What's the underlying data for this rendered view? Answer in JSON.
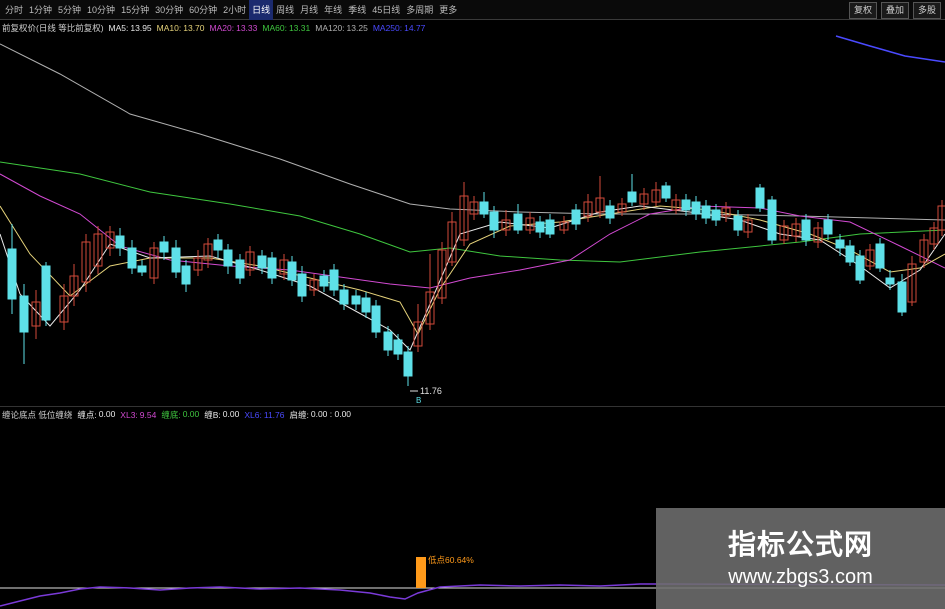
{
  "toolbar": {
    "tabs": [
      {
        "label": "分时",
        "active": false
      },
      {
        "label": "1分钟",
        "active": false
      },
      {
        "label": "5分钟",
        "active": false
      },
      {
        "label": "10分钟",
        "active": false
      },
      {
        "label": "15分钟",
        "active": false
      },
      {
        "label": "30分钟",
        "active": false
      },
      {
        "label": "60分钟",
        "active": false
      },
      {
        "label": "2小时",
        "active": false
      },
      {
        "label": "日线",
        "active": true
      },
      {
        "label": "周线",
        "active": false
      },
      {
        "label": "月线",
        "active": false
      },
      {
        "label": "年线",
        "active": false
      },
      {
        "label": "季线",
        "active": false
      },
      {
        "label": "45日线",
        "active": false
      },
      {
        "label": "多周期",
        "active": false
      },
      {
        "label": "更多",
        "active": false
      }
    ],
    "right_buttons": [
      "复权",
      "叠加",
      "多股"
    ]
  },
  "main_legend": {
    "title": "前复权价(日线 等比前复权)",
    "items": [
      {
        "label": "MA5:",
        "value": "13.95",
        "color": "#e8e8e8"
      },
      {
        "label": "MA10:",
        "value": "13.70",
        "color": "#e5d27a"
      },
      {
        "label": "MA20:",
        "value": "13.33",
        "color": "#d24ad2"
      },
      {
        "label": "MA60:",
        "value": "13.31",
        "color": "#3fc63f"
      },
      {
        "label": "MA120:",
        "value": "13.25",
        "color": "#b0b0b0"
      },
      {
        "label": "MA250:",
        "value": "14.77",
        "color": "#4a4aff"
      }
    ]
  },
  "sub_legend": {
    "title": "缠论底点 低位缠绕",
    "items": [
      {
        "label": "缠点:",
        "value": "0.00",
        "color": "#e8e8e8"
      },
      {
        "label": "XL3:",
        "value": "9.54",
        "color": "#d24ad2"
      },
      {
        "label": "缠底:",
        "value": "0.00",
        "color": "#3fc63f"
      },
      {
        "label": "缠B:",
        "value": "0.00",
        "color": "#e8e8e8"
      },
      {
        "label": "XL6:",
        "value": "11.76",
        "color": "#4a4aff"
      },
      {
        "label": "启缠:",
        "value": "0.00 : 0.00",
        "color": "#e8e8e8"
      }
    ]
  },
  "main_chart": {
    "low_label": "11.76",
    "low_marker": "B",
    "colors": {
      "up": "#d24a3a",
      "down": "#5ee0e8",
      "ma5": "#e8e8e8",
      "ma10": "#e5d27a",
      "ma20": "#d24ad2",
      "ma60": "#3fc63f",
      "ma120": "#b0b0b0",
      "ma250": "#4a4aff"
    }
  },
  "sub_chart": {
    "signal_label": "低点60.64%",
    "colors": {
      "bar": "#ff9a1a",
      "line": "#7a3ad8",
      "ref": "#e0e0e0"
    }
  },
  "watermark": {
    "title": "指标公式网",
    "url": "www.zbgs3.com"
  }
}
